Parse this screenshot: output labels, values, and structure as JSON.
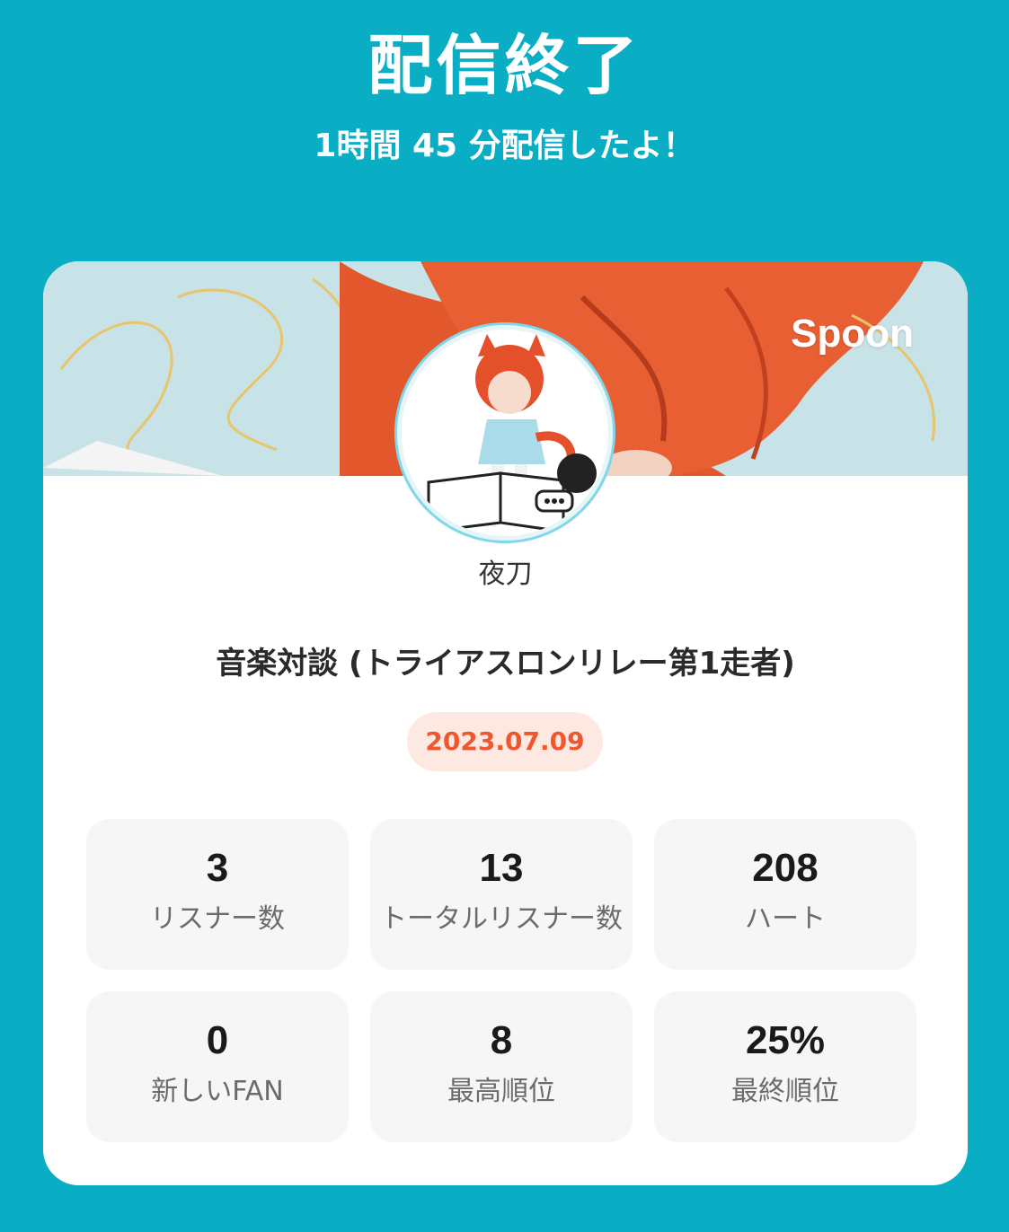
{
  "header": {
    "title": "配信終了",
    "subtitle": "1時間 45 分配信したよ！"
  },
  "card": {
    "brand": "Spoon",
    "avatar_text": "夜刀",
    "username": "夜刀",
    "live_title": "音楽対談 (トライアスロンリレー第1走者)",
    "date": "2023.07.09",
    "stats": [
      {
        "value": "3",
        "label": "リスナー数"
      },
      {
        "value": "13",
        "label": "トータルリスナー数"
      },
      {
        "value": "208",
        "label": "ハート"
      },
      {
        "value": "0",
        "label": "新しいFAN"
      },
      {
        "value": "8",
        "label": "最高順位"
      },
      {
        "value": "25%",
        "label": "最終順位"
      }
    ]
  },
  "colors": {
    "background": "#0aaec4",
    "date_text": "#f0572e",
    "date_pill": "#fde8e2"
  }
}
